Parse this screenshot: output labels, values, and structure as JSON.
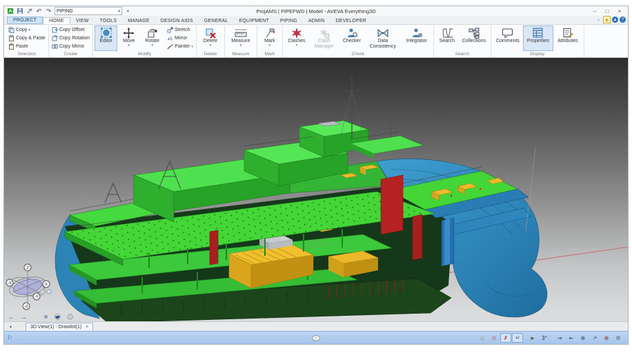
{
  "window": {
    "title": "ProjAMS | PIPEFWD | Model - AVEVA Everything3D",
    "controls": {
      "minimize": "–",
      "restore": "□",
      "close": "×"
    }
  },
  "qat": {
    "combo_value": "PIPING",
    "combo_arrow": "▾",
    "customize_arrow": "▾",
    "undo": "↶",
    "redo": "↷"
  },
  "tabs": {
    "items": [
      {
        "label": "PROJECT"
      },
      {
        "label": "HOME"
      },
      {
        "label": "VIEW"
      },
      {
        "label": "TOOLS"
      },
      {
        "label": "MANAGE"
      },
      {
        "label": "DESIGN AIDS"
      },
      {
        "label": "GENERAL"
      },
      {
        "label": "EQUIPMENT"
      },
      {
        "label": "PIPING"
      },
      {
        "label": "ADMIN"
      },
      {
        "label": "DEVELOPER"
      }
    ],
    "active": "HOME"
  },
  "tabrow_icons": {
    "pin": "∘",
    "diamond": "◆",
    "collapse": "▲",
    "help": "?"
  },
  "ribbon": {
    "dd_glyph": "▾",
    "groups": [
      {
        "label": "Selection",
        "items": [
          {
            "label": "Copy"
          },
          {
            "label": "Copy & Paste"
          },
          {
            "label": "Paste"
          }
        ]
      },
      {
        "label": "Create",
        "items": [
          {
            "label": "Copy Offset"
          },
          {
            "label": "Copy Rotation"
          },
          {
            "label": "Copy Mirror"
          }
        ]
      },
      {
        "label": "Modify",
        "large": [
          {
            "label": "Editor"
          },
          {
            "label": "Move"
          },
          {
            "label": "Rotate"
          }
        ],
        "small": [
          {
            "label": "Stretch"
          },
          {
            "label": "Mirror"
          },
          {
            "label": "Painter"
          }
        ]
      },
      {
        "label": "Delete",
        "large": [
          {
            "label": "Delete"
          }
        ]
      },
      {
        "label": "Measure",
        "large": [
          {
            "label": "Measure"
          }
        ]
      },
      {
        "label": "Mark",
        "large": [
          {
            "label": "Mark"
          }
        ]
      },
      {
        "label": "Check",
        "large": [
          {
            "label": "Clashes"
          },
          {
            "label": "Clash Manager"
          },
          {
            "label": "Checker"
          },
          {
            "label": "Data Consistency"
          },
          {
            "label": "Integrator"
          }
        ]
      },
      {
        "label": "Search",
        "large": [
          {
            "label": "Search"
          },
          {
            "label": "Collections"
          }
        ]
      },
      {
        "label": "Display",
        "large": [
          {
            "label": "Comments"
          },
          {
            "label": "Properties"
          },
          {
            "label": "Attributes"
          }
        ]
      }
    ]
  },
  "viewport": {
    "nav_back": "←",
    "nav_forward": "→",
    "doc_tab_dd": "▾",
    "doc_tab_label": "3D View(1) - Drawlist(1)",
    "doc_tab_close": "×",
    "compass": {
      "z": "Z",
      "zneg": "-Z",
      "x": "X",
      "xneg": "-X",
      "yneg": "-Y"
    }
  },
  "statusbar": {
    "flag": "⚐",
    "icons": [
      {
        "name": "grid-toggle",
        "glyph": "▦",
        "color": "#a9b6c4",
        "active": false
      },
      {
        "name": "lock-toggle",
        "glyph": "⊠",
        "color": "#b48a92",
        "active": false
      },
      {
        "name": "snap-off-toggle",
        "glyph": "✗",
        "color": "#c22a2a",
        "active": true
      },
      {
        "name": "snap-ref-toggle",
        "glyph": "¹²",
        "color": "#333333",
        "active": true
      },
      {
        "name": "cursor-snap-toggle",
        "glyph": "►",
        "color": "#5a5a2a",
        "active": false
      },
      {
        "name": "angle-snap-toggle",
        "glyph": "3°",
        "color": "#333333",
        "active": false
      },
      {
        "name": "move-in-tool",
        "glyph": "⇥",
        "color": "#33506e",
        "active": false
      },
      {
        "name": "move-out-tool",
        "glyph": "⇤",
        "color": "#33506e",
        "active": false
      },
      {
        "name": "origin-tool",
        "glyph": "⊕",
        "color": "#33506e",
        "active": false
      },
      {
        "name": "rotate-step-tool",
        "glyph": "↗",
        "color": "#33506e",
        "active": false
      },
      {
        "name": "target-tool",
        "glyph": "⊕",
        "color": "#a03030",
        "active": false
      },
      {
        "name": "settings-tool",
        "glyph": "⚙",
        "color": "#55616e",
        "active": false
      }
    ]
  },
  "palette": {
    "deck_green": "#43d636",
    "hull_blue": "#2e86ba",
    "equipment_yellow": "#eebb2c",
    "bulkhead_red": "#b42222",
    "axis_red": "#c96a6a",
    "statusbar_blue": "#aecdf0",
    "tab_highlight_blue": "#cfe3f7",
    "selection_blue": "#d9e7f7"
  }
}
